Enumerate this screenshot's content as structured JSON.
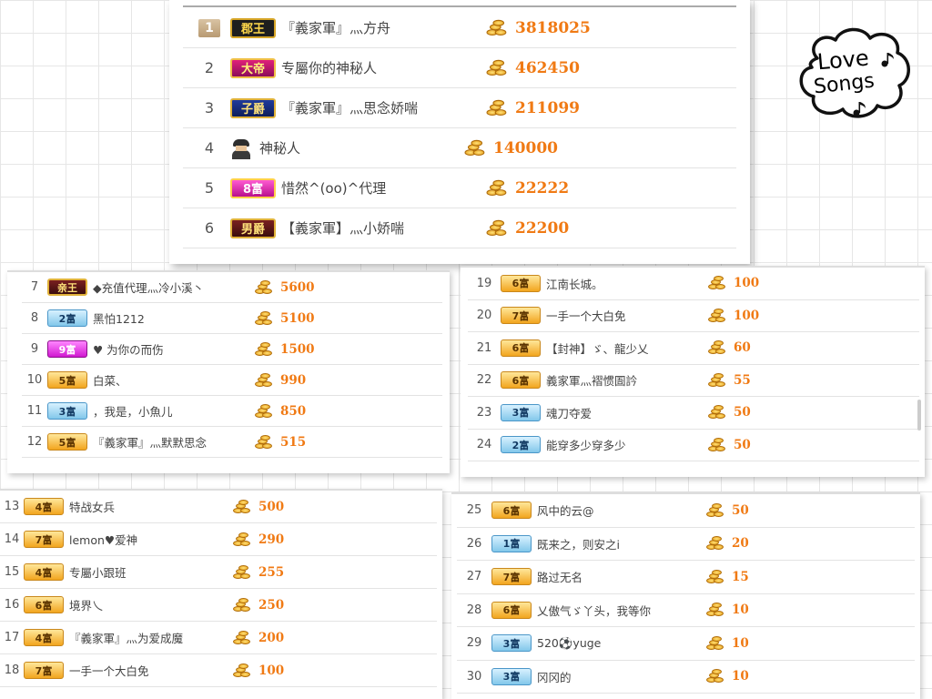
{
  "logo": {
    "line1": "Love",
    "line2": "Songs"
  },
  "top": [
    {
      "rank": "1",
      "badge": "郡王",
      "badge_style": "black",
      "name": "『義家軍』灬方舟",
      "score": "3818025"
    },
    {
      "rank": "2",
      "badge": "大帝",
      "badge_style": "emperor",
      "name": "专屬你的神秘人",
      "score": "462450"
    },
    {
      "rank": "3",
      "badge": "子爵",
      "badge_style": "navy",
      "name": "『義家軍』灬思念娇喘",
      "score": "211099"
    },
    {
      "rank": "4",
      "badge": "",
      "badge_style": "spy",
      "name": "神秘人",
      "score": "140000"
    },
    {
      "rank": "5",
      "badge": "8富",
      "badge_style": "purple",
      "name": "惜然^(oo)^代理",
      "score": "22222"
    },
    {
      "rank": "6",
      "badge": "男爵",
      "badge_style": "royal",
      "name": "【義家軍】灬小娇喘",
      "score": "22200"
    }
  ],
  "list_a": [
    {
      "rank": "7",
      "badge": "亲王",
      "badge_style": "royal",
      "name": "◆充值代理灬冷小溪丶",
      "score": "5600"
    },
    {
      "rank": "8",
      "badge": "2富",
      "badge_style": "blue",
      "name": "黑怕1212",
      "score": "5100"
    },
    {
      "rank": "9",
      "badge": "9富",
      "badge_style": "magenta",
      "name": "♥ 为你の而伤",
      "score": "1500"
    },
    {
      "rank": "10",
      "badge": "5富",
      "badge_style": "gold",
      "name": "白菜、",
      "score": "990"
    },
    {
      "rank": "11",
      "badge": "3富",
      "badge_style": "blue",
      "name": "，我是，小魚儿",
      "score": "850"
    },
    {
      "rank": "12",
      "badge": "5富",
      "badge_style": "gold",
      "name": "『義家軍』灬默默思念",
      "score": "515"
    }
  ],
  "list_b": [
    {
      "rank": "19",
      "badge": "6富",
      "badge_style": "gold",
      "name": "江南长城。",
      "score": "100"
    },
    {
      "rank": "20",
      "badge": "7富",
      "badge_style": "gold",
      "name": "一手一个大白免",
      "score": "100"
    },
    {
      "rank": "21",
      "badge": "6富",
      "badge_style": "gold",
      "name": "【封神】ゞ、龍少乂",
      "score": "60"
    },
    {
      "rank": "22",
      "badge": "6富",
      "badge_style": "gold",
      "name": "義家軍灬褶惯圄訡",
      "score": "55"
    },
    {
      "rank": "23",
      "badge": "3富",
      "badge_style": "blue",
      "name": "魂刀夺爱",
      "score": "50"
    },
    {
      "rank": "24",
      "badge": "2富",
      "badge_style": "blue",
      "name": "能穿多少穿多少",
      "score": "50"
    }
  ],
  "list_c": [
    {
      "rank": "13",
      "badge": "4富",
      "badge_style": "gold",
      "name": "特战女兵",
      "score": "500"
    },
    {
      "rank": "14",
      "badge": "7富",
      "badge_style": "gold",
      "name": "lemon♥爱神",
      "score": "290"
    },
    {
      "rank": "15",
      "badge": "4富",
      "badge_style": "gold",
      "name": "专屬小跟班",
      "score": "255"
    },
    {
      "rank": "16",
      "badge": "6富",
      "badge_style": "gold",
      "name": "境界乀",
      "score": "250"
    },
    {
      "rank": "17",
      "badge": "4富",
      "badge_style": "gold",
      "name": "『義家軍』灬为爱成魔",
      "score": "200"
    },
    {
      "rank": "18",
      "badge": "7富",
      "badge_style": "gold",
      "name": "一手一个大白免",
      "score": "100"
    }
  ],
  "list_d": [
    {
      "rank": "25",
      "badge": "6富",
      "badge_style": "gold",
      "name": "风中的云@",
      "score": "50"
    },
    {
      "rank": "26",
      "badge": "1富",
      "badge_style": "blue",
      "name": "既来之，则安之i",
      "score": "20"
    },
    {
      "rank": "27",
      "badge": "7富",
      "badge_style": "gold",
      "name": "路过无名",
      "score": "15"
    },
    {
      "rank": "28",
      "badge": "6富",
      "badge_style": "gold",
      "name": "乂傲气ゞ丫头，我等你",
      "score": "10"
    },
    {
      "rank": "29",
      "badge": "3富",
      "badge_style": "blue",
      "name": "520⚽yuge",
      "score": "10"
    },
    {
      "rank": "30",
      "badge": "3富",
      "badge_style": "blue",
      "name": "冈冈的",
      "score": "10"
    }
  ]
}
